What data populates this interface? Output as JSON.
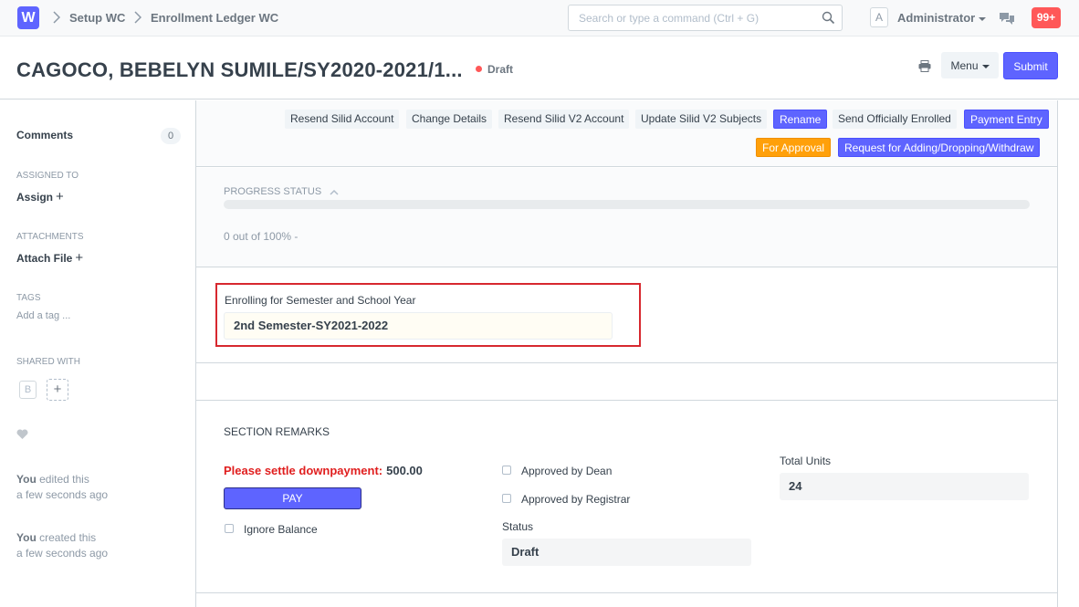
{
  "navbar": {
    "logo_letter": "W",
    "breadcrumbs": [
      "Setup WC",
      "Enrollment Ledger WC"
    ],
    "search_placeholder": "Search or type a command (Ctrl + G)",
    "user_initial": "A",
    "user_name": "Administrator",
    "notification_count": "99+"
  },
  "page_head": {
    "title": "CAGOCO, BEBELYN SUMILE/SY2020-2021/1...",
    "status": "Draft",
    "menu_label": "Menu",
    "submit_label": "Submit"
  },
  "sidebar": {
    "comments_label": "Comments",
    "comments_count": "0",
    "assigned_to_label": "ASSIGNED TO",
    "assign_label": "Assign",
    "attachments_label": "ATTACHMENTS",
    "attach_label": "Attach File",
    "tags_label": "TAGS",
    "add_tag_label": "Add a tag ...",
    "shared_with_label": "SHARED WITH",
    "shared_user_initial": "B",
    "activity": [
      {
        "who": "You",
        "action": " edited this",
        "when": "a few seconds ago"
      },
      {
        "who": "You",
        "action": " created this",
        "when": "a few seconds ago"
      }
    ]
  },
  "actions": {
    "row1": [
      {
        "label": "Resend Silid Account",
        "style": "default"
      },
      {
        "label": "Change Details",
        "style": "default"
      },
      {
        "label": "Resend Silid V2 Account",
        "style": "default"
      },
      {
        "label": "Update Silid V2 Subjects",
        "style": "default"
      },
      {
        "label": "Rename",
        "style": "primary"
      },
      {
        "label": "Send Officially Enrolled",
        "style": "default"
      },
      {
        "label": "Payment Entry",
        "style": "primary"
      }
    ],
    "row2": [
      {
        "label": "For Approval",
        "style": "warning"
      },
      {
        "label": "Request for Adding/Dropping/Withdraw",
        "style": "primary"
      }
    ]
  },
  "progress": {
    "heading": "PROGRESS STATUS",
    "percent": 0,
    "text": "0 out of 100% -"
  },
  "enrollment": {
    "label": "Enrolling for Semester and School Year",
    "value": "2nd Semester-SY2021-2022"
  },
  "remarks": {
    "heading": "SECTION REMARKS",
    "downpayment_label": "Please settle downpayment:",
    "downpayment_value": "500.00",
    "pay_label": "PAY",
    "ignore_balance_label": "Ignore Balance",
    "approved_dean_label": "Approved by Dean",
    "approved_registrar_label": "Approved by Registrar",
    "status_label": "Status",
    "status_value": "Draft",
    "total_units_label": "Total Units",
    "total_units_value": "24"
  },
  "colors": {
    "primary": "#5e64ff",
    "warning": "#ffa00a",
    "danger": "#ff5858",
    "highlight_border": "#d7282f"
  }
}
